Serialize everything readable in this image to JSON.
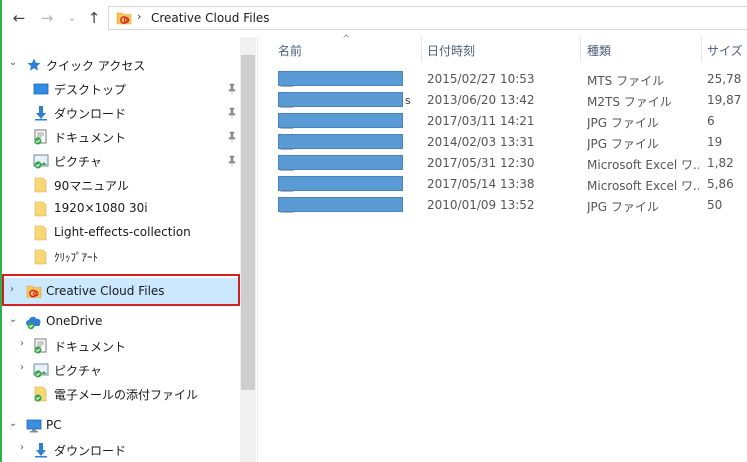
{
  "address": {
    "back_label": "←",
    "forward_label": "→",
    "dropdown_label": "⌄",
    "up_label": "↑",
    "separator": "›",
    "path": "Creative Cloud Files"
  },
  "nav": {
    "quick_access": "クイック アクセス",
    "desktop": "デスクトップ",
    "downloads": "ダウンロード",
    "documents": "ドキュメント",
    "pictures": "ピクチャ",
    "folder_90": "90マニュアル",
    "folder_1920": "1920×1080 30i",
    "folder_light": "Light-effects-collection",
    "folder_clip": "ｸﾘｯﾌﾟｱｰﾄ",
    "creative_cloud": "Creative Cloud Files",
    "onedrive": "OneDrive",
    "od_documents": "ドキュメント",
    "od_pictures": "ピクチャ",
    "od_attachments": "電子メールの添付ファイル",
    "pc": "PC",
    "pc_downloads": "ダウンロード"
  },
  "columns": {
    "name": "名前",
    "date": "日付時刻",
    "type": "種類",
    "size": "サイズ"
  },
  "files": [
    {
      "date": "2015/02/27 10:53",
      "type": "MTS ファイル",
      "size": "25,78",
      "tail": ""
    },
    {
      "date": "2013/06/20 13:42",
      "type": "M2TS ファイル",
      "size": "19,87",
      "tail": "s"
    },
    {
      "date": "2017/03/11 14:21",
      "type": "JPG ファイル",
      "size": "6",
      "tail": ""
    },
    {
      "date": "2014/02/03 13:31",
      "type": "JPG ファイル",
      "size": "19",
      "tail": ""
    },
    {
      "date": "2017/05/31 12:30",
      "type": "Microsoft Excel ワ...",
      "size": "1,82",
      "tail": ""
    },
    {
      "date": "2017/05/14 13:38",
      "type": "Microsoft Excel ワ...",
      "size": "5,86",
      "tail": ""
    },
    {
      "date": "2010/01/09 13:52",
      "type": "JPG ファイル",
      "size": "50",
      "tail": ""
    }
  ],
  "colors": {
    "selection": "#cce8ff",
    "highlight_border": "#d32020",
    "redaction": "#5b9bd5",
    "header_text": "#4c607a"
  }
}
